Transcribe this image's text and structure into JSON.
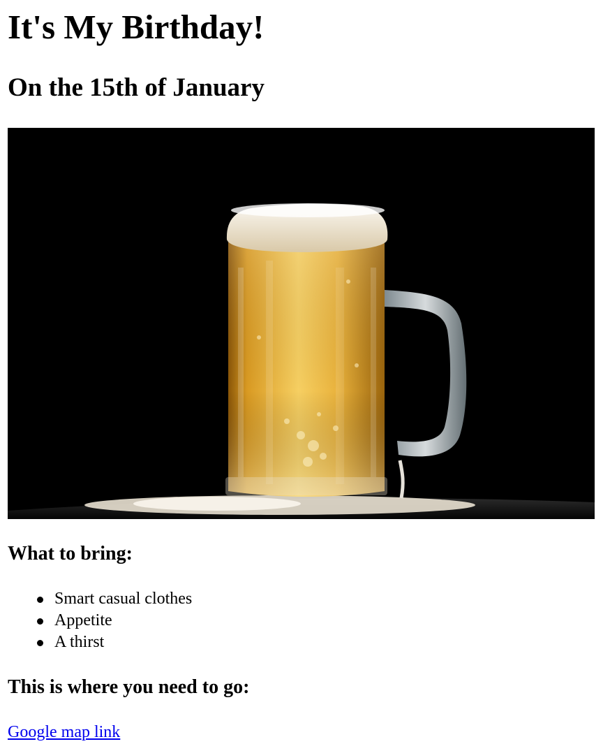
{
  "page": {
    "title": "It's My Birthday!",
    "subtitle": "On the 15th of January"
  },
  "image": {
    "alt": "",
    "subject": "beer-mug",
    "colors": {
      "background": "#000000",
      "beer_light": "#f4c85a",
      "beer_dark": "#b07010",
      "foam": "#f3ede2",
      "glass": "#d9e2e6"
    }
  },
  "bring": {
    "heading": "What to bring:",
    "items": [
      "Smart casual clothes",
      "Appetite",
      "A thirst"
    ]
  },
  "location": {
    "heading": "This is where you need to go:",
    "link_text": "Google map link"
  },
  "colors": {
    "link": "#0000ee",
    "text": "#000000"
  }
}
